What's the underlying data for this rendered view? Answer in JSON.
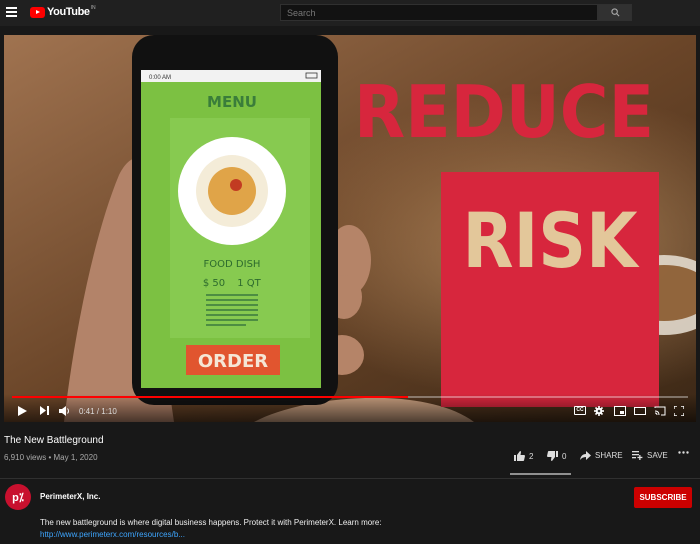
{
  "header": {
    "logo_text": "YouTube",
    "logo_country": "IN",
    "search_placeholder": "Search"
  },
  "video": {
    "overlay": {
      "headline_1": "REDUCE",
      "headline_2": "RISK",
      "phone_time": "0:00 AM",
      "menu_title": "MENU",
      "dish_name": "FOOD DISH",
      "dish_price": "$ 50",
      "dish_qty": "1 QT",
      "order_label": "ORDER"
    },
    "time_display": "0:41 / 1:10",
    "progress": 0.586,
    "cc_label": "CC"
  },
  "info": {
    "title": "The New Battleground",
    "views_date": "6,910 views • May 1, 2020",
    "likes": "2",
    "dislikes": "0",
    "share_label": "SHARE",
    "save_label": "SAVE"
  },
  "channel": {
    "name": "PerimeterX, Inc.",
    "avatar_text": "p⁒",
    "subscribe_label": "SUBSCRIBE",
    "description": "The new battleground is where digital business happens. Protect it with PerimeterX. Learn more:",
    "link": "http://www.perimeterx.com/resources/b..."
  },
  "colors": {
    "accent": "#ff0000",
    "subscribe": "#cc0000",
    "link": "#3ea6ff",
    "headline": "#d7263d"
  }
}
